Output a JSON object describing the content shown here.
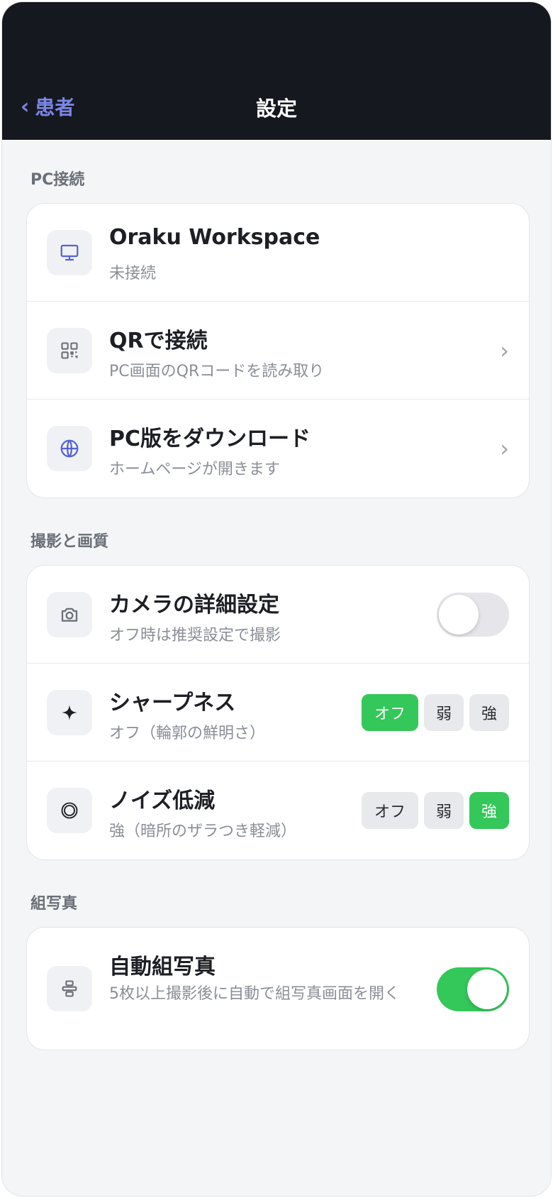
{
  "header": {
    "back_label": "患者",
    "title": "設定"
  },
  "sections": {
    "pc": {
      "label": "PC接続",
      "items": [
        {
          "title": "Oraku Workspace",
          "subtitle": "未接続"
        },
        {
          "title": "QRで接続",
          "subtitle": "PC画面のQRコードを読み取り"
        },
        {
          "title": "PC版をダウンロード",
          "subtitle": "ホームページが開きます"
        }
      ]
    },
    "capture": {
      "label": "撮影と画質",
      "camera": {
        "title": "カメラの詳細設定",
        "subtitle": "オフ時は推奨設定で撮影",
        "enabled": false
      },
      "sharpness": {
        "title": "シャープネス",
        "subtitle": "オフ（輪郭の鮮明さ）",
        "options": [
          "オフ",
          "弱",
          "強"
        ],
        "selected": "オフ"
      },
      "noise": {
        "title": "ノイズ低減",
        "subtitle": "強（暗所のザラつき軽減）",
        "options": [
          "オフ",
          "弱",
          "強"
        ],
        "selected": "強"
      }
    },
    "collage": {
      "label": "組写真",
      "auto": {
        "title": "自動組写真",
        "subtitle": "5枚以上撮影後に自動で組写真画面を開く",
        "enabled": true
      }
    }
  },
  "colors": {
    "accent": "#7b86e8",
    "toggle_on": "#34c759",
    "header_bg": "#161820"
  },
  "icons": [
    "monitor-icon",
    "qr-code-icon",
    "globe-icon",
    "camera-icon",
    "sparkle-icon",
    "noise-circles-icon",
    "collage-icon",
    "chevron-right-icon",
    "chevron-left-icon"
  ]
}
